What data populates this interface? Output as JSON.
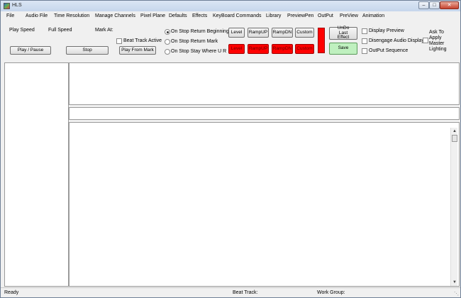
{
  "window": {
    "title": "HLS"
  },
  "menu": [
    "File",
    "Audio File",
    "Time Resolution",
    "Manage Channels",
    "Pixel Plane",
    "Defaults",
    "Effects",
    "KeyBoard Commands",
    "Library",
    "PreviewPen",
    "OutPut",
    "PreView",
    "Animation"
  ],
  "toolbar": {
    "play_speed_label": "Play Speed",
    "full_speed_label": "Full Speed",
    "mark_at_label": "Mark At:",
    "beat_track_label": "Beat Track Active",
    "play_pause": "Play / Pause",
    "stop": "Stop",
    "play_from_mark": "Play From Mark",
    "radio_options": [
      "On Stop Return Beginning",
      "On Stop Return Mark",
      "On Stop Stay Where U R"
    ],
    "radio_selected": 0,
    "effect_buttons": [
      "Level",
      "RampUP",
      "RampDN",
      "Custom"
    ],
    "effect_buttons_red": [
      "Level",
      "RampUP",
      "RampDN",
      "Custom"
    ],
    "undo": "UnDo Last Effect",
    "save": "Save",
    "checkboxes": [
      "Display Preview",
      "Disengage Audio Display",
      "OutPut Sequence"
    ],
    "master_lighting_label": "Ask To Apply Master Lighting"
  },
  "status": {
    "ready": "Ready",
    "beat_track": "Beat Track:",
    "work_group": "Work Group:"
  },
  "colors": {
    "effect_red": "#ff0000",
    "save_green": "#bff0bf"
  }
}
